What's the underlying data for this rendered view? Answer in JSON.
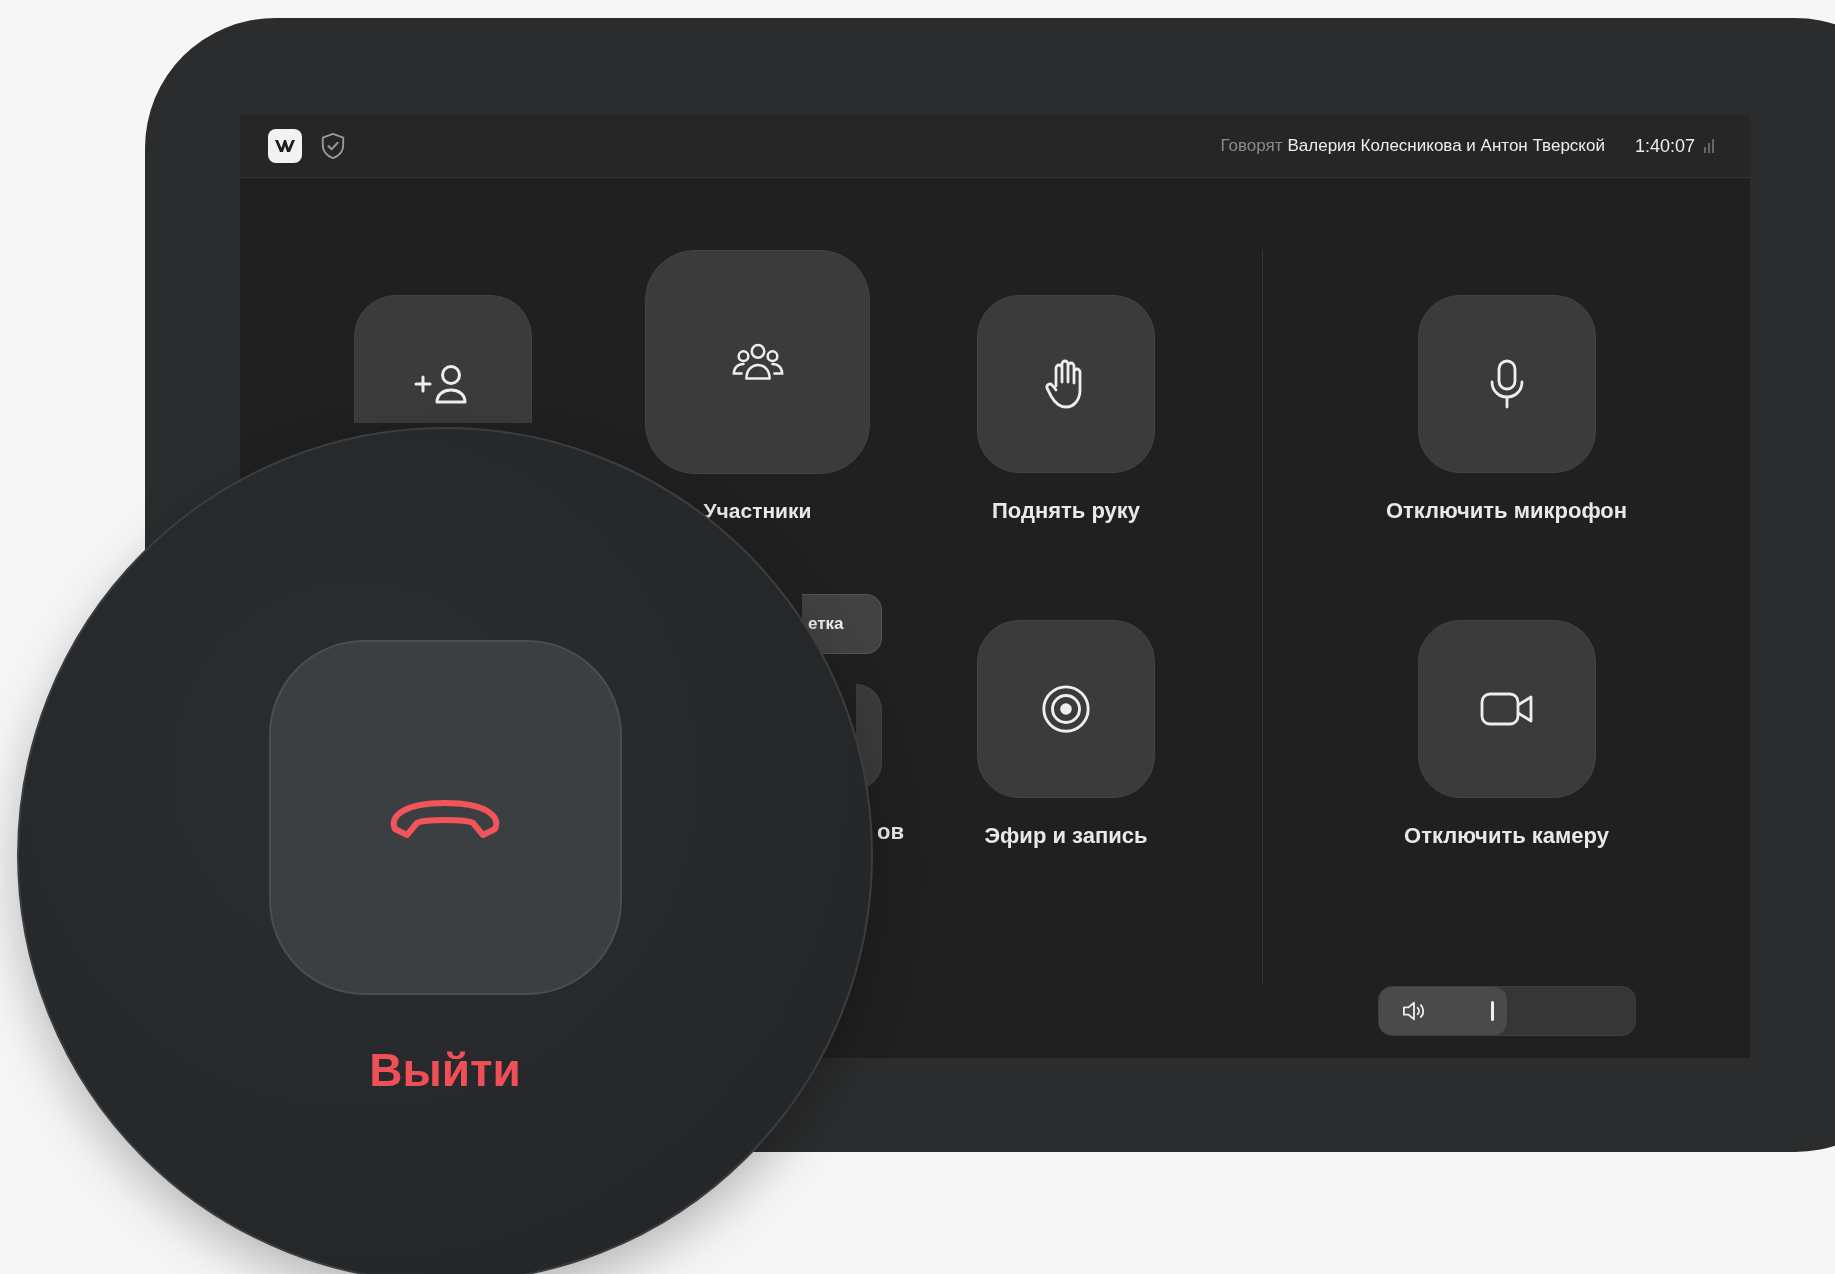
{
  "topbar": {
    "speaking_label": "Говорят",
    "speakers": "Валерия Колесникова и Антон Тверской",
    "time": "1:40:07"
  },
  "actions": [
    {
      "kind": "add_person"
    },
    {
      "kind": "participants",
      "label": "Участники"
    },
    {
      "kind": "raise_hand",
      "label": "Поднять руку"
    },
    {
      "kind": "layout",
      "label": "етка"
    },
    {
      "kind": "partial",
      "label": "ов"
    },
    {
      "kind": "broadcast",
      "label": "Эфир и запись"
    }
  ],
  "media": [
    {
      "kind": "mic",
      "label": "Отключить микрофон"
    },
    {
      "kind": "camera",
      "label": "Отключить камеру"
    }
  ],
  "volume": {
    "level": 0.5
  },
  "leave": {
    "label": "Выйти"
  }
}
